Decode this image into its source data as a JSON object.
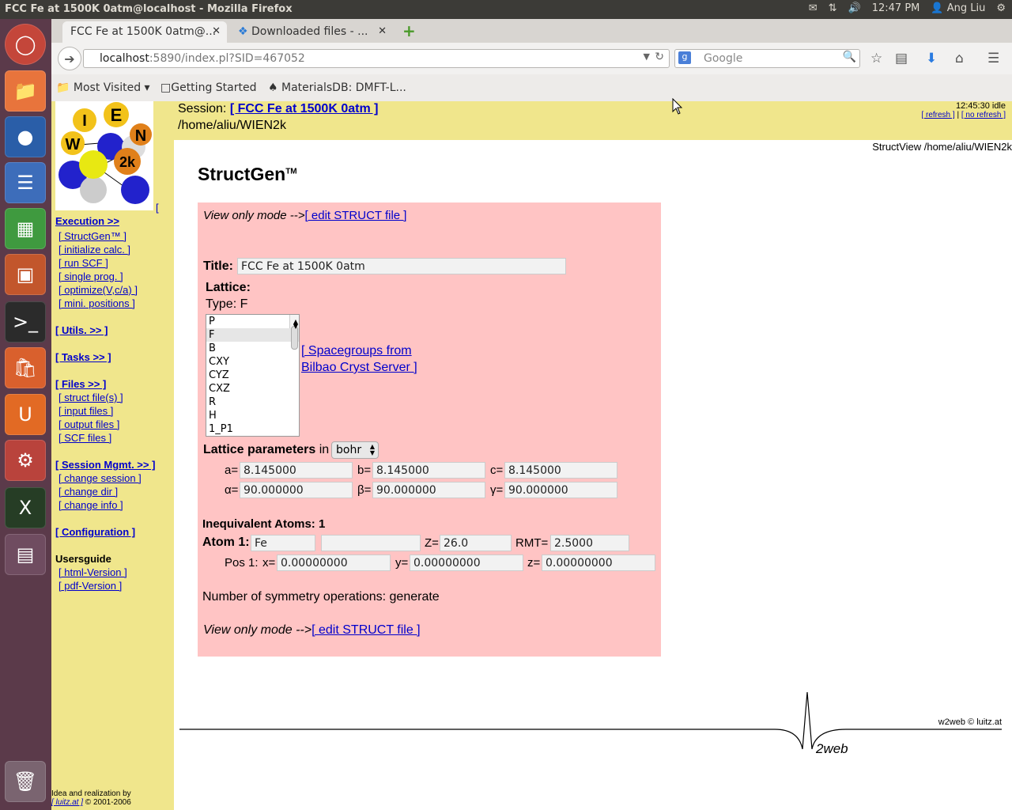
{
  "os": {
    "window_title": "FCC Fe at 1500K 0atm@localhost - Mozilla Firefox",
    "tray": {
      "time": "12:47 PM",
      "user": "Ang Liu"
    }
  },
  "launcher": {
    "items": [
      "ubuntu-dash",
      "files",
      "firefox",
      "writer",
      "calc",
      "impress",
      "terminal",
      "software-center",
      "ubuntu-one",
      "system-settings",
      "xterm",
      "workspace-switcher",
      "trash"
    ]
  },
  "browser": {
    "tabs": [
      {
        "label": "FCC Fe at 1500K 0atm@...",
        "active": true
      },
      {
        "label": "Downloaded files - ...",
        "active": false
      }
    ],
    "url_host": "localhost",
    "url_rest": ":5890/index.pl?SID=467052",
    "search_placeholder": "Google",
    "bookmarks": [
      "Most Visited",
      "Getting Started",
      "MaterialsDB: DMFT-L..."
    ]
  },
  "session": {
    "label": "Session:",
    "name_link": "[ FCC Fe at 1500K 0atm ]",
    "path": "/home/aliu/WIEN2k",
    "status_time": "12:45:30 idle",
    "refresh": "[ refresh ]",
    "separator": "|",
    "no_refresh": "[ no refresh ]",
    "structview": "StructView /home/aliu/WIEN2k"
  },
  "sidebar": {
    "bracket": "[",
    "execution": "Execution >>",
    "execution_items": [
      "[ StructGen™ ]",
      "[ initialize calc. ]",
      "[ run SCF ]",
      "[ single prog. ]",
      "[ optimize(V,c/a) ]",
      "[ mini. positions ]"
    ],
    "utils": "[ Utils. >> ]",
    "tasks": "[ Tasks >> ]",
    "files": "[ Files >> ]",
    "files_items": [
      "[ struct file(s) ]",
      "[ input files ]",
      "[ output files ]",
      "[ SCF files ]"
    ],
    "session_mgmt": "[ Session Mgmt. >> ]",
    "session_items": [
      "[ change session ]",
      "[ change dir ]",
      "[ change info ]"
    ],
    "configuration": "[ Configuration ]",
    "usersguide": "Usersguide",
    "guide_items": [
      "[ html-Version ]",
      "[ pdf-Version ]"
    ],
    "credit_line1": "Idea and realization by",
    "credit_link": "[ luitz.at ]",
    "credit_year": "© 2001-2006"
  },
  "structgen": {
    "heading": "StructGen",
    "tm": "TM",
    "view_only": "View only mode -->",
    "edit_link": "[ edit STRUCT file ]",
    "title_label": "Title:",
    "title_value": "FCC Fe at 1500K 0atm",
    "lattice_label": "Lattice:",
    "type_label": "Type: F",
    "lattice_types": [
      "P",
      "F",
      "B",
      "CXY",
      "CYZ",
      "CXZ",
      "R",
      "H",
      "1_P1"
    ],
    "selected_type": "F",
    "spacegroups_line1": "[ Spacegroups from",
    "spacegroups_line2": "Bilbao Cryst Server ]",
    "params_label": "Lattice parameters",
    "params_in": "in",
    "unit": "bohr",
    "a_label": "a=",
    "a": "8.145000",
    "b_label": "b=",
    "b": "8.145000",
    "c_label": "c=",
    "c": "8.145000",
    "alpha_label": "α=",
    "alpha": "90.000000",
    "beta_label": "β=",
    "beta": "90.000000",
    "gamma_label": "γ=",
    "gamma": "90.000000",
    "ineq_label": "Inequivalent Atoms: 1",
    "atom_label": "Atom 1:",
    "atom_name": "Fe",
    "atom_extra": "",
    "z_label": "Z=",
    "z": "26.0",
    "rmt_label": "RMT=",
    "rmt": "2.5000",
    "pos_label": "Pos 1:",
    "x_label": "x=",
    "x": "0.00000000",
    "y_label": "y=",
    "y": "0.00000000",
    "zpos_label": "z=",
    "zpos": "0.00000000",
    "symops": "Number of symmetry operations: generate"
  },
  "footer": {
    "copyright": "w2web © luitz.at",
    "logo_text": "2web"
  }
}
